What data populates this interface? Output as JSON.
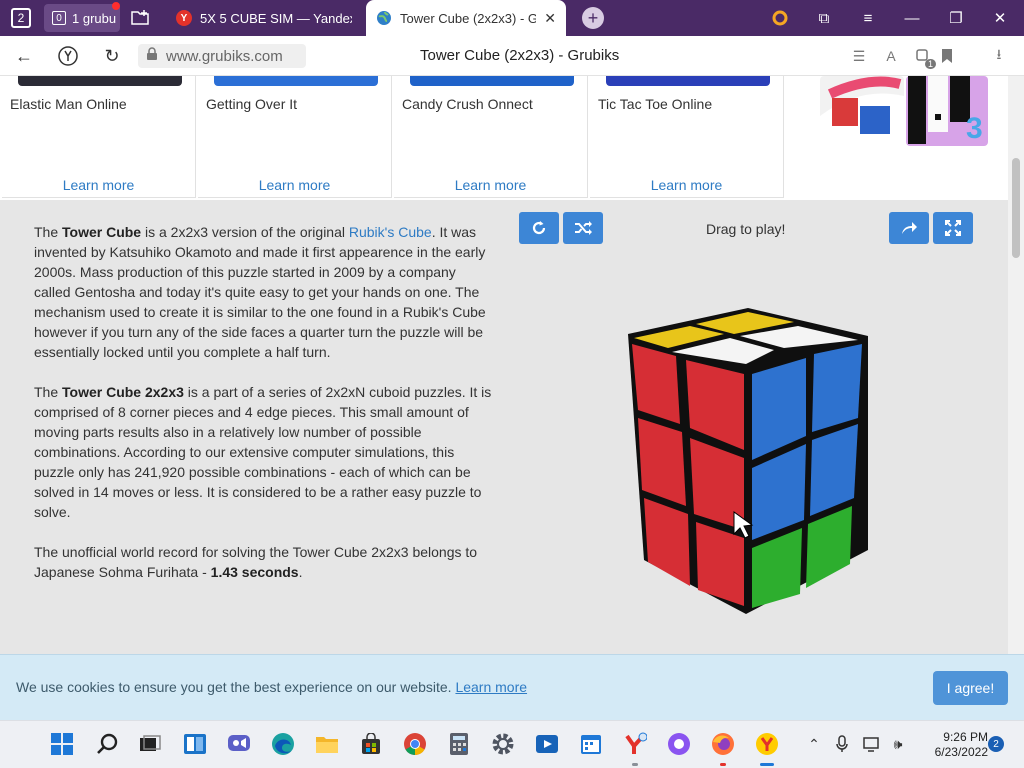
{
  "browser": {
    "tab_count": "2",
    "group_count": "0",
    "group_label": "1 grubu",
    "tabs": [
      {
        "title": "5X 5 CUBE SIM — Yandex",
        "favicon": "Y",
        "active": false
      },
      {
        "title": "Tower Cube (2x2x3) - Grubiks",
        "favicon": "globe",
        "active": true
      }
    ],
    "url": "www.grubiks.com",
    "page_title": "Tower Cube (2x2x3) - Grubiks",
    "translate_label": "A",
    "extension_badge": "1"
  },
  "related_games": [
    {
      "name": "Elastic Man Online",
      "learn": "Learn more",
      "thumb_color": "#2b2b36"
    },
    {
      "name": "Getting Over It",
      "learn": "Learn more",
      "thumb_color": "#2b6fd6"
    },
    {
      "name": "Candy Crush Onnect",
      "learn": "Learn more",
      "thumb_color": "#1f62c9"
    },
    {
      "name": "Tic Tac Toe Online",
      "learn": "Learn more",
      "thumb_color": "#2a3fb8"
    }
  ],
  "promo_label": "3",
  "description": {
    "p1": {
      "t1": "The ",
      "b1": "Tower Cube",
      "t2": " is a 2x2x3 version of the original ",
      "link": "Rubik's Cube",
      "t3": ". It was invented by Katsuhiko Okamoto and made it first appearence in the early 2000s. Mass production of this puzzle started in 2009 by a company called Gentosha and today it's quite easy to get your hands on one. The mechanism used to create it is similar to the one found in a Rubik's Cube however if you turn any of the side faces a quarter turn the puzzle will be essentially locked until you complete a half turn."
    },
    "p2": {
      "t1": "The ",
      "b1": "Tower Cube 2x2x3",
      "t2": " is a part of a series of 2x2xN cuboid puzzles. It is comprised of 8 corner pieces and 4 edge pieces. This small amount of moving parts results also in a relatively low number of possible combinations. According to our extensive computer simulations, this puzzle only has 241,920 possible combinations - each of which can be solved in 14 moves or less. It is considered to be a rather easy puzzle to solve."
    },
    "p3": {
      "t1": "The unofficial world record for solving the Tower Cube 2x2x3 belongs to Japanese Sohma Furihata - ",
      "b1": "1.43 seconds",
      "t2": "."
    }
  },
  "simulator": {
    "drag_hint": "Drag to play!",
    "buttons": [
      "reset-icon",
      "shuffle-icon",
      "share-icon",
      "fullscreen-icon"
    ],
    "colors": {
      "top": [
        "#e8c51a",
        "#e8c51a",
        "#f4f4f4",
        "#f4f4f4"
      ],
      "left": "#d62e35",
      "right_top": "#2e72cf",
      "right_bottom": "#2dae2e"
    }
  },
  "cookie": {
    "text": "We use cookies to ensure you get the best experience on our website.",
    "link": "Learn more",
    "agree": "I agree!"
  },
  "taskbar": {
    "apps": [
      "start-icon",
      "search-icon",
      "task-view-icon",
      "widgets-icon",
      "chat-icon",
      "edge-icon",
      "file-explorer-icon",
      "store-icon",
      "chrome-icon",
      "calculator-icon",
      "settings-icon",
      "media-player-icon",
      "calendar-icon",
      "yandex-icon",
      "alice-icon",
      "firefox-icon",
      "yandex-browser-icon"
    ],
    "time": "9:26 PM",
    "date": "6/23/2022",
    "notifications": "2"
  }
}
